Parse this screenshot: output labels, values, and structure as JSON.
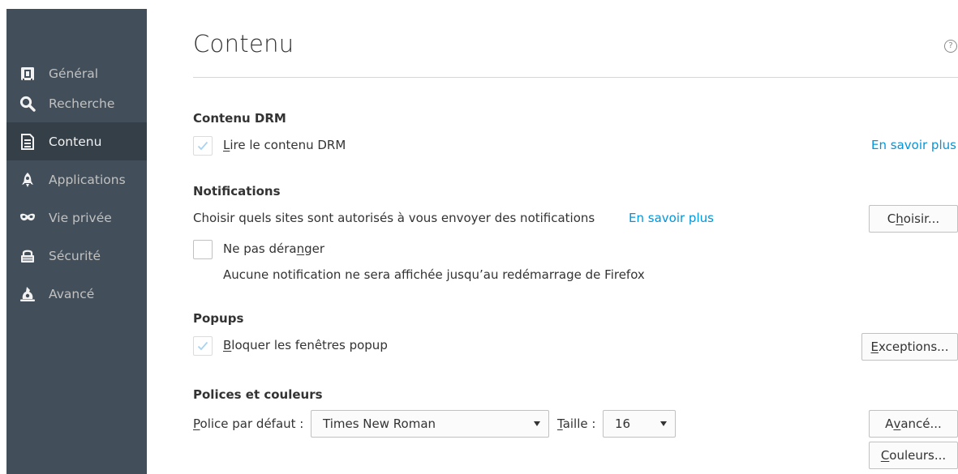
{
  "sidebar": {
    "items": [
      {
        "label": "Général",
        "icon": "general-icon",
        "active": false
      },
      {
        "label": "Recherche",
        "icon": "search-icon",
        "active": false
      },
      {
        "label": "Contenu",
        "icon": "content-icon",
        "active": true
      },
      {
        "label": "Applications",
        "icon": "applications-icon",
        "active": false
      },
      {
        "label": "Vie privée",
        "icon": "privacy-mask-icon",
        "active": false
      },
      {
        "label": "Sécurité",
        "icon": "security-icon",
        "active": false
      },
      {
        "label": "Avancé",
        "icon": "advanced-icon",
        "active": false
      }
    ]
  },
  "header": {
    "title": "Contenu",
    "help_icon": "help-icon"
  },
  "drm": {
    "title": "Contenu DRM",
    "checkbox_label_accesskey": "L",
    "checkbox_label_rest": "ire le contenu DRM",
    "checked": true,
    "learn_more": "En savoir plus"
  },
  "notifications": {
    "title": "Notifications",
    "description": "Choisir quels sites sont autorisés à vous envoyer des notifications",
    "learn_more": "En savoir plus",
    "choose_button_pre": "C",
    "choose_button_key": "h",
    "choose_button_post": "oisir...",
    "dnd_label_pre": "Ne pas déra",
    "dnd_label_key": "n",
    "dnd_label_post": "ger",
    "dnd_checked": false,
    "dnd_note": "Aucune notification ne sera affichée jusqu’au redémarrage de Firefox"
  },
  "popups": {
    "title": "Popups",
    "checkbox_label_key": "B",
    "checkbox_label_rest": "loquer les fenêtres popup",
    "checked": true,
    "exceptions_key": "E",
    "exceptions_rest": "xceptions..."
  },
  "fonts": {
    "title": "Polices et couleurs",
    "default_font_key": "P",
    "default_font_rest": "olice par défaut :",
    "default_font_value": "Times New Roman",
    "size_key": "T",
    "size_rest": "aille :",
    "size_value": "16",
    "advanced_pre": "A",
    "advanced_key": "v",
    "advanced_post": "ancé...",
    "colors_key": "C",
    "colors_rest": "ouleurs..."
  },
  "colors": {
    "sidebar_bg": "#424f5a",
    "sidebar_active_bg": "#343f48",
    "link": "#0096dd",
    "check": "#4aa6e0"
  }
}
